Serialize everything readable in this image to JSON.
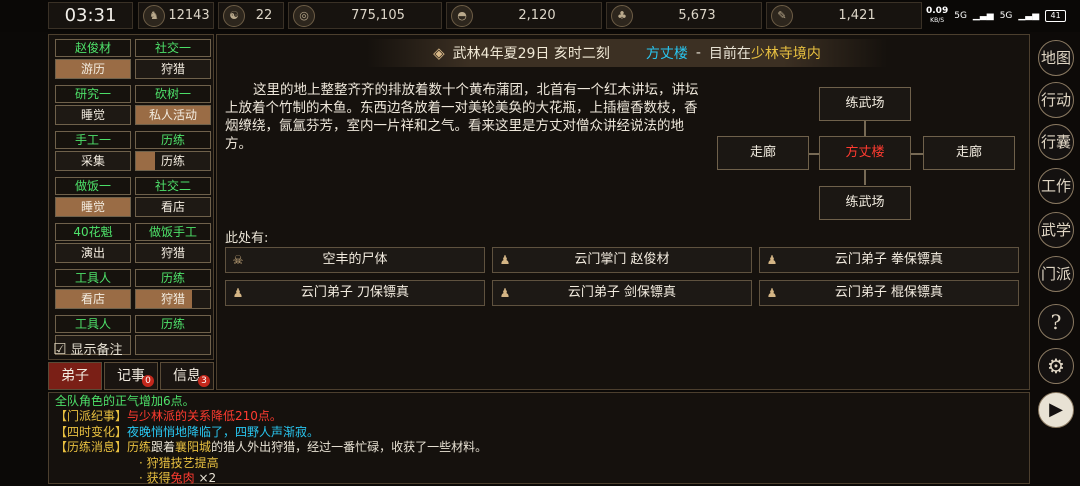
{
  "topbar": {
    "clock": "03:31",
    "stats": [
      {
        "icon": "head-icon",
        "glyph": "♞",
        "value": "12143"
      },
      {
        "icon": "yin-yang-icon",
        "glyph": "☯",
        "value": "22"
      },
      {
        "icon": "coin-icon",
        "glyph": "◎",
        "value": "775,105"
      },
      {
        "icon": "food-bowl-icon",
        "glyph": "◓",
        "value": "2,120"
      },
      {
        "icon": "herb-icon",
        "glyph": "♣",
        "value": "5,673"
      },
      {
        "icon": "scroll-icon",
        "glyph": "✎",
        "value": "1,421"
      }
    ],
    "system": {
      "speed": "0.09",
      "speed_unit": "KB/S",
      "net1": "5G",
      "net2": "5G",
      "battery": "41"
    }
  },
  "disciples": [
    {
      "name": "赵俊材",
      "activity": "游历",
      "progress": 1.0
    },
    {
      "name": "社交一",
      "activity": "狩猎",
      "progress": 0.0
    },
    {
      "name": "研究一",
      "activity": "睡觉",
      "progress": 0.0
    },
    {
      "name": "砍树一",
      "activity": "私人活动",
      "progress": 1.0
    },
    {
      "name": "手工一",
      "activity": "采集",
      "progress": 0.0
    },
    {
      "name": "历练",
      "activity": "历练",
      "progress": 0.25
    },
    {
      "name": "做饭一",
      "activity": "睡觉",
      "progress": 1.0
    },
    {
      "name": "社交二",
      "activity": "看店",
      "progress": 0.0
    },
    {
      "name": "40花魁",
      "activity": "演出",
      "progress": 0.0
    },
    {
      "name": "做饭手工",
      "activity": "狩猎",
      "progress": 0.0
    },
    {
      "name": "工具人",
      "activity": "看店",
      "progress": 1.0
    },
    {
      "name": "历练",
      "activity": "狩猎",
      "progress": 0.75
    },
    {
      "name": "工具人",
      "activity": "",
      "progress": 0.0
    },
    {
      "name": "历练",
      "activity": "",
      "progress": 0.0
    }
  ],
  "show_note": "显示备注",
  "tabs": [
    {
      "label": "弟子",
      "badge": ""
    },
    {
      "label": "记事",
      "badge": "0"
    },
    {
      "label": "信息",
      "badge": "3"
    }
  ],
  "location": {
    "date": "武林4年夏29日 亥时二刻",
    "place": "方丈楼",
    "separator": "-",
    "now_at_prefix": "目前在",
    "region": "少林寺境内",
    "description": "这里的地上整整齐齐的排放着数十个黄布蒲团，北首有一个红木讲坛，讲坛上放着个竹制的木鱼。东西边各放着一对美轮美奂的大花瓶，上插檀香数枝，香烟缭绕，氤氲芬芳，室内一片祥和之气。看来这里是方丈对僧众讲经说法的地方。"
  },
  "map": {
    "north": "练武场",
    "west": "走廊",
    "center": "方丈楼",
    "east": "走廊",
    "south": "练武场"
  },
  "here_label": "此处有:",
  "entities": [
    {
      "label": "空丰的尸体",
      "icon": "skull-icon",
      "glyph": "☠"
    },
    {
      "label": "云门掌门 赵俊材",
      "icon": "person-icon",
      "glyph": "♟"
    },
    {
      "label": "云门弟子 拳保镖真",
      "icon": "person-icon",
      "glyph": "♟"
    },
    {
      "label": "云门弟子 刀保镖真",
      "icon": "person-icon",
      "glyph": "♟"
    },
    {
      "label": "云门弟子 剑保镖真",
      "icon": "person-icon",
      "glyph": "♟"
    },
    {
      "label": "云门弟子 棍保镖真",
      "icon": "person-icon",
      "glyph": "♟"
    }
  ],
  "log": {
    "line1": "全队角色的正气增加6点。",
    "line2_tag": "【门派纪事】",
    "line2_text": "与少林派的关系降低210点。",
    "line3_tag": "【四时变化】",
    "line3_text": "夜晚悄悄地降临了，四野人声渐寂。",
    "line4_tag": "【历练消息】",
    "line4_a": "历练",
    "line4_b": "跟着",
    "line4_c": "襄阳城",
    "line4_d": "的猎人外出狩猎，经过一番忙碌，收获了一些材料。",
    "line5": "· 狩猎技艺提高",
    "line6_a": "· 获得",
    "line6_b": "兔肉",
    "line6_c": " ×2"
  },
  "sidebar": [
    {
      "label": "地图",
      "icon": "map-icon"
    },
    {
      "label": "行动",
      "icon": "action-icon"
    },
    {
      "label": "行囊",
      "icon": "bag-icon"
    },
    {
      "label": "工作",
      "icon": "work-icon"
    },
    {
      "label": "武学",
      "icon": "martial-icon"
    },
    {
      "label": "门派",
      "icon": "sect-icon"
    },
    {
      "label": "?",
      "icon": "help-icon"
    },
    {
      "label": "⚙",
      "icon": "settings-icon"
    },
    {
      "label": "▶",
      "icon": "play-icon"
    }
  ],
  "colors": {
    "green": "#4ee26a",
    "cyan": "#29c6f0",
    "red": "#ff3b30",
    "gold": "#e8c040",
    "progress": "#9a6c45"
  }
}
